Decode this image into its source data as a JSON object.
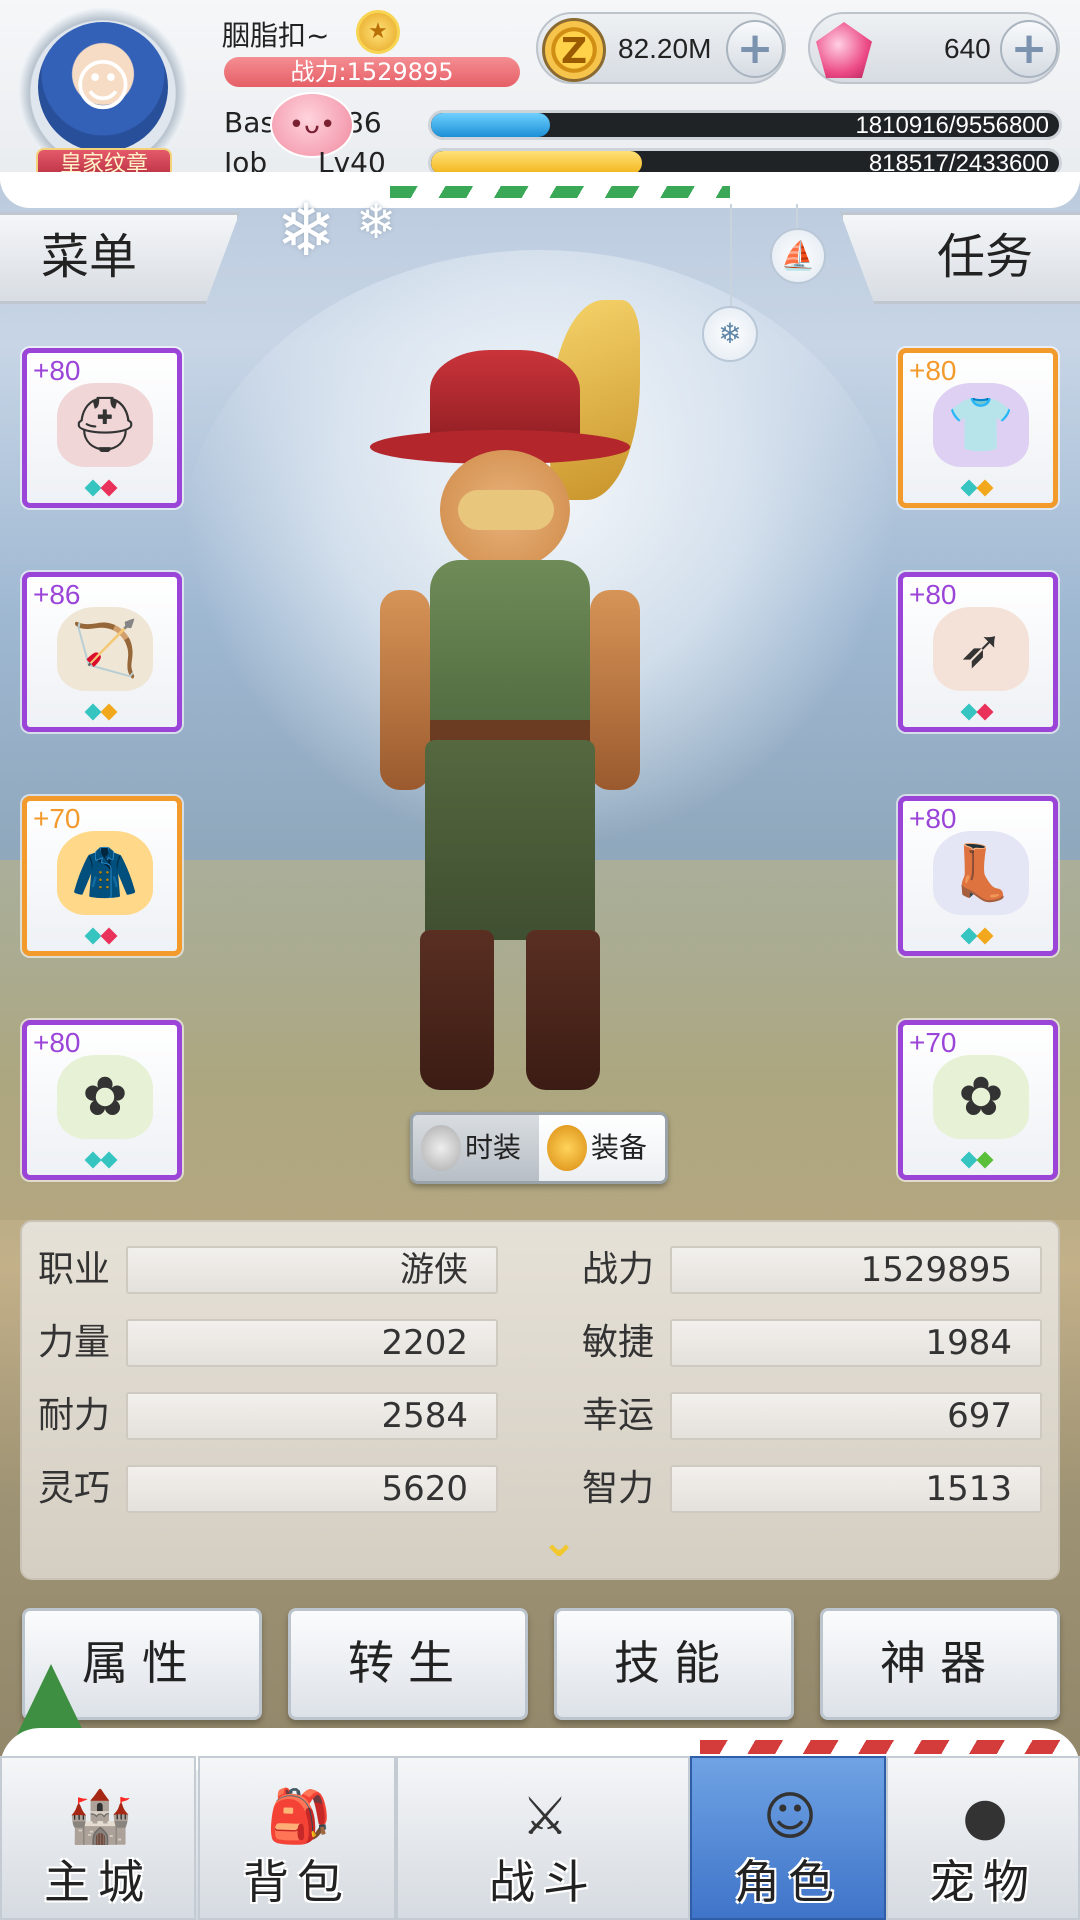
{
  "header": {
    "player_name": "胭脂扣~",
    "combat_power_text": "战力:1529895",
    "emblem": "皇家纹章",
    "base_label": "Bas",
    "base_level": "86",
    "job_label": "Job",
    "job_level": "Lv40",
    "base_exp_text": "1810916/9556800",
    "base_exp_fraction": 0.19,
    "job_exp_text": "818517/2433600",
    "job_exp_fraction": 0.336,
    "zeny": "82.20M",
    "gems": "640",
    "plus_symbol": "+"
  },
  "tabs": {
    "menu": "菜单",
    "quest": "任务"
  },
  "equipment": {
    "left": [
      {
        "level": "+80",
        "icon": "helmet-icon",
        "border": "#9b45d8",
        "gems": [
          "#35c4c0",
          "#e8325a"
        ]
      },
      {
        "level": "+86",
        "icon": "bow-icon",
        "border": "#9b45d8",
        "gems": [
          "#35c4c0",
          "#f2a81c"
        ]
      },
      {
        "level": "+70",
        "icon": "cape-icon",
        "border": "#f39a2d",
        "gems": [
          "#35c4c0",
          "#e8325a"
        ]
      },
      {
        "level": "+80",
        "icon": "flower-wreath-icon",
        "border": "#9b45d8",
        "gems": [
          "#35c4c0",
          "#35c4c0"
        ]
      }
    ],
    "right": [
      {
        "level": "+80",
        "icon": "armor-icon",
        "border": "#f39a2d",
        "gems": [
          "#35c4c0",
          "#f2a81c"
        ]
      },
      {
        "level": "+80",
        "icon": "arrow-icon",
        "border": "#9b45d8",
        "gems": [
          "#35c4c0",
          "#e8325a"
        ]
      },
      {
        "level": "+80",
        "icon": "boots-icon",
        "border": "#9b45d8",
        "gems": [
          "#35c4c0",
          "#f2a81c"
        ]
      },
      {
        "level": "+70",
        "icon": "flower-wreath-icon",
        "border": "#9b45d8",
        "gems": [
          "#35c4c0",
          "#5cbf3a"
        ]
      }
    ]
  },
  "toggle": {
    "fashion": "时装",
    "equipment": "装备"
  },
  "stats": {
    "left": [
      {
        "label": "职业",
        "value": "游侠"
      },
      {
        "label": "力量",
        "value": "2202"
      },
      {
        "label": "耐力",
        "value": "2584"
      },
      {
        "label": "灵巧",
        "value": "5620"
      }
    ],
    "right": [
      {
        "label": "战力",
        "value": "1529895"
      },
      {
        "label": "敏捷",
        "value": "1984"
      },
      {
        "label": "幸运",
        "value": "697"
      },
      {
        "label": "智力",
        "value": "1513"
      }
    ]
  },
  "actions": [
    "属性",
    "转生",
    "技能",
    "神器"
  ],
  "nav": [
    {
      "label": "主城",
      "icon": "castle-icon"
    },
    {
      "label": "背包",
      "icon": "backpack-icon"
    },
    {
      "label": "战斗",
      "icon": "crossed-swords-icon"
    },
    {
      "label": "角色",
      "icon": "character-icon",
      "active": true
    },
    {
      "label": "宠物",
      "icon": "pet-icon"
    }
  ]
}
